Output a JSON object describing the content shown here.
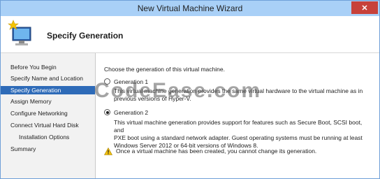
{
  "window": {
    "title": "New Virtual Machine Wizard",
    "close_label": "✕"
  },
  "header": {
    "title": "Specify Generation",
    "icon": "computer-star-icon"
  },
  "sidebar": {
    "items": [
      {
        "label": "Before You Begin",
        "active": false,
        "sub": false
      },
      {
        "label": "Specify Name and Location",
        "active": false,
        "sub": false
      },
      {
        "label": "Specify Generation",
        "active": true,
        "sub": false
      },
      {
        "label": "Assign Memory",
        "active": false,
        "sub": false
      },
      {
        "label": "Configure Networking",
        "active": false,
        "sub": false
      },
      {
        "label": "Connect Virtual Hard Disk",
        "active": false,
        "sub": false
      },
      {
        "label": "Installation Options",
        "active": false,
        "sub": true
      },
      {
        "label": "Summary",
        "active": false,
        "sub": false
      }
    ]
  },
  "main": {
    "prompt": "Choose the generation of this virtual machine.",
    "gen1": {
      "label": "Generation 1",
      "desc_line1": "This virtual machine generation provides the same virtual hardware to the virtual machine as in",
      "desc_line2": "previous versions of Hyper-V.",
      "selected": false
    },
    "gen2": {
      "label": "Generation 2",
      "desc_line1": "This virtual machine generation provides support for features such as Secure Boot, SCSI boot, and",
      "desc_line2": "PXE boot using a standard network adapter. Guest operating systems must be running at least",
      "desc_line3": "Windows Server 2012 or 64-bit versions of Windows 8.",
      "selected": true
    },
    "warning": {
      "text": "Once a virtual machine has been created, you cannot change its generation.",
      "icon": "warning-icon"
    }
  },
  "watermark": "CodeEase.com",
  "colors": {
    "titlebar": "#a9d0f7",
    "selection": "#2e6bb8",
    "close": "#c7413a"
  }
}
